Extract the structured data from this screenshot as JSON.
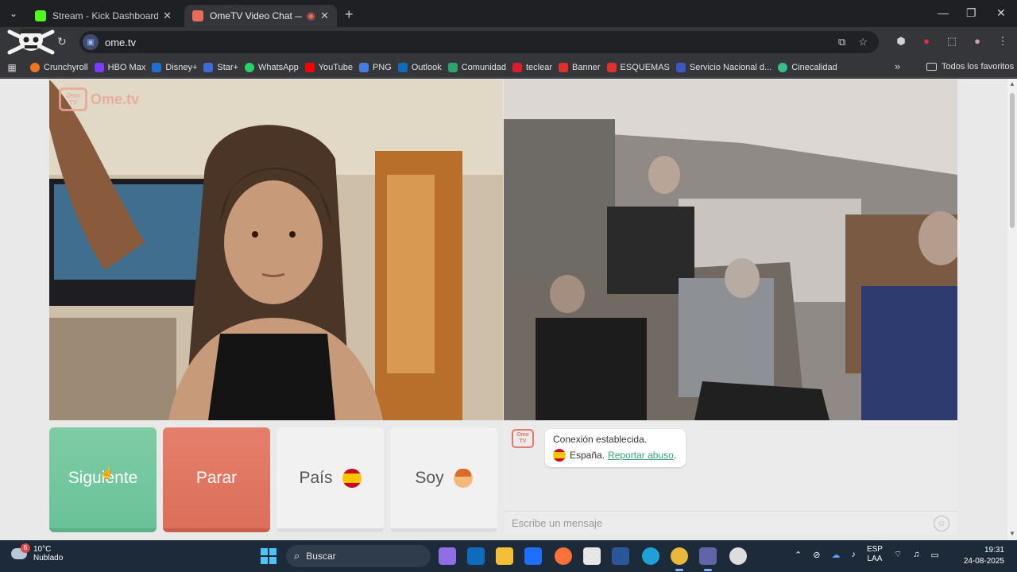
{
  "browser": {
    "tabs": [
      {
        "title": "Stream - Kick Dashboard",
        "active": false,
        "favicon_color": "#53fc18"
      },
      {
        "title": "OmeTV Video Chat — Ome",
        "active": true,
        "favicon_color": "#e86a58"
      }
    ],
    "url": "ome.tv",
    "window_controls": {
      "minimize": "—",
      "maximize": "❐",
      "close": "✕"
    }
  },
  "bookmarks": {
    "items": [
      {
        "label": "Crunchyroll",
        "color": "#f47521"
      },
      {
        "label": "HBO Max",
        "color": "#7a3cff"
      },
      {
        "label": "Disney+",
        "color": "#1d6fd6"
      },
      {
        "label": "Star+",
        "color": "#3b6bd8"
      },
      {
        "label": "WhatsApp",
        "color": "#25d366"
      },
      {
        "label": "YouTube",
        "color": "#ff0000"
      },
      {
        "label": "PNG",
        "color": "#4a7be0"
      },
      {
        "label": "Outlook",
        "color": "#0f6cbd"
      },
      {
        "label": "Comunidad",
        "color": "#2ea36f"
      },
      {
        "label": "teclear",
        "color": "#d91d2a"
      },
      {
        "label": "Banner",
        "color": "#e0302b"
      },
      {
        "label": "ESQUEMAS",
        "color": "#e0302b"
      },
      {
        "label": "Servicio Nacional d...",
        "color": "#3a57c4"
      },
      {
        "label": "Cinecalidad",
        "color": "#35c08a"
      }
    ],
    "more": "»",
    "favorites": "Todos los favoritos"
  },
  "ometv": {
    "logo_box": "Ome TV",
    "logo_text": "Ome.tv",
    "buttons": {
      "next": "Siguiente",
      "stop": "Parar",
      "country": "País",
      "gender": "Soy"
    },
    "chat": {
      "avatar": "Ome TV",
      "line1": "Conexión establecida.",
      "country": "España.",
      "report_link": "Reportar abuso",
      "report_suffix": ".",
      "input_placeholder": "Escribe un mensaje"
    }
  },
  "taskbar": {
    "weather_temp": "10°C",
    "weather_desc": "Nublado",
    "weather_badge": "6",
    "search_label": "Buscar",
    "language_top": "ESP",
    "language_bottom": "LAA",
    "time": "19:31",
    "date": "24-08-2025",
    "apps": [
      {
        "name": "copilot-icon",
        "color": "#8f6ee8"
      },
      {
        "name": "outlook-icon",
        "color": "#0f6cbd"
      },
      {
        "name": "file-explorer-icon",
        "color": "#f2c037"
      },
      {
        "name": "dropbox-icon",
        "color": "#1e6fff"
      },
      {
        "name": "firefox-icon",
        "color": "#ff7139"
      },
      {
        "name": "amazon-icon",
        "color": "#e6e6e6"
      },
      {
        "name": "word-icon",
        "color": "#2b579a"
      },
      {
        "name": "edge-icon",
        "color": "#1fa0d8"
      },
      {
        "name": "chrome-icon",
        "color": "#e8b93a"
      },
      {
        "name": "teams-icon",
        "color": "#6264a7"
      },
      {
        "name": "app-icon",
        "color": "#dddddd"
      }
    ]
  }
}
